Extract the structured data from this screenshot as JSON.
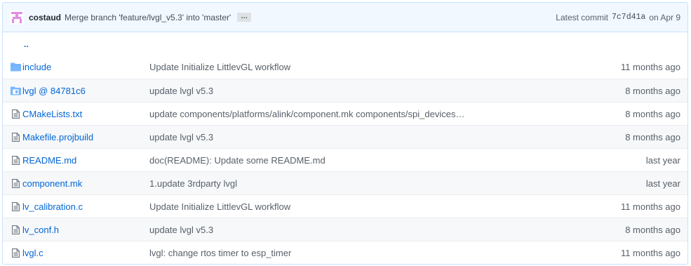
{
  "commit": {
    "author": "costaud",
    "message": "Merge branch 'feature/lvgl_v5.3' into 'master'",
    "ellipsis": "…",
    "latest_label": "Latest commit",
    "sha": "7c7d41a",
    "date": "on Apr 9"
  },
  "parent_link": "..",
  "files": [
    {
      "icon": "folder-icon",
      "name": "include",
      "message": "Update Initialize LittlevGL workflow",
      "age": "11 months ago"
    },
    {
      "icon": "submodule-icon",
      "name": "lvgl @ 84781c6",
      "message": "update lvgl v5.3",
      "age": "8 months ago"
    },
    {
      "icon": "file-icon",
      "name": "CMakeLists.txt",
      "message": "update components/platforms/alink/component.mk components/spi_devices…",
      "age": "8 months ago"
    },
    {
      "icon": "file-icon",
      "name": "Makefile.projbuild",
      "message": "update lvgl v5.3",
      "age": "8 months ago"
    },
    {
      "icon": "file-icon",
      "name": "README.md",
      "message": "doc(README): Update some README.md",
      "age": "last year"
    },
    {
      "icon": "file-icon",
      "name": "component.mk",
      "message": "1.update 3rdparty lvgl",
      "age": "last year"
    },
    {
      "icon": "file-icon",
      "name": "lv_calibration.c",
      "message": "Update Initialize LittlevGL workflow",
      "age": "11 months ago"
    },
    {
      "icon": "file-icon",
      "name": "lv_conf.h",
      "message": "update lvgl v5.3",
      "age": "8 months ago"
    },
    {
      "icon": "file-icon",
      "name": "lvgl.c",
      "message": "lvgl: change rtos timer to esp_timer",
      "age": "11 months ago"
    }
  ],
  "colors": {
    "accent": "#0366d6",
    "avatar": "#e58ce5",
    "header_bg": "#f1f8ff"
  }
}
